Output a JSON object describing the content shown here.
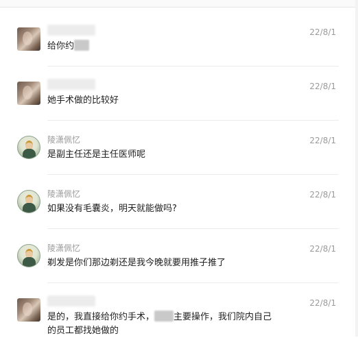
{
  "messages": [
    {
      "sender": "",
      "sender_hidden": true,
      "avatar": "photo-avatar",
      "time": "22/8/1",
      "text": "给你约",
      "text_tail_masked": true
    },
    {
      "sender": "",
      "sender_hidden": true,
      "avatar": "photo-avatar",
      "time": "22/8/1",
      "text": "她手术做的比较好"
    },
    {
      "sender": "陵潇佩忆",
      "avatar": "cartoon-avatar",
      "time": "22/8/1",
      "text": "是副主任还是主任医师呢"
    },
    {
      "sender": "陵潇佩忆",
      "avatar": "cartoon-avatar",
      "time": "22/8/1",
      "text": "如果没有毛囊炎，明天就能做吗?"
    },
    {
      "sender": "陵潇佩忆",
      "avatar": "cartoon-avatar",
      "time": "22/8/1",
      "text": "剃发是你们那边剃还是我今晚就要用推子推了"
    },
    {
      "sender": "",
      "sender_hidden": true,
      "avatar": "photo-avatar",
      "time": "22/8/1",
      "text_part1": "是的，我直接给你约手术，",
      "text_part2": "主要操作，我们院内自己",
      "text_line2": "的员工都找她做的"
    }
  ]
}
